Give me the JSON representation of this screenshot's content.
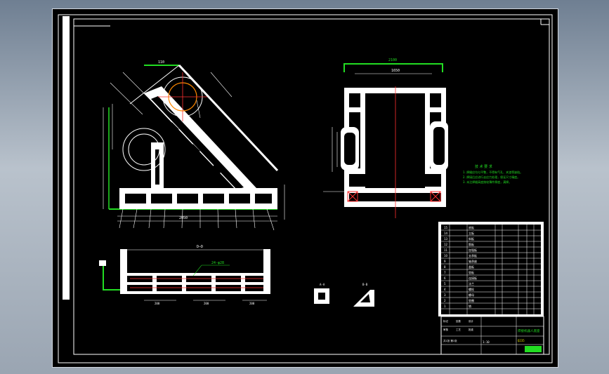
{
  "views": {
    "front_dim_top": "110",
    "front_dim_bottom": "2050",
    "top_view_overall": "2100",
    "top_view_inner": "1650",
    "side_view_label": "D—D",
    "side_dim_label": "24-φ28",
    "section_a_label": "A-A",
    "section_b_label": "B-B",
    "side_bottom_dims": [
      "200",
      "200",
      "200"
    ]
  },
  "notes": {
    "title": "技 术 要 求",
    "lines": [
      "1. 焊缝应均匀平整，不得有气孔、夹渣等缺陷。",
      "2. 焊接后应进行去应力处理，保证尺寸精度。",
      "3. 未注焊缝高度按较薄件厚度，满焊。"
    ]
  },
  "title_block": {
    "drawing_name": "焊接机器人底座",
    "scale": "1:10",
    "material": "Q235",
    "sheet": "共1张 第1张",
    "labels": [
      "标记",
      "处数",
      "设计",
      "审核",
      "工艺",
      "批准"
    ],
    "parts": [
      "底板",
      "立板",
      "斜板",
      "筋板",
      "加强板",
      "支承板",
      "轴承座",
      "盖板",
      "垫板",
      "连接板",
      "法兰",
      "螺栓",
      "螺母",
      "垫圈",
      "销"
    ]
  },
  "colors": {
    "outline": "#ffffff",
    "dimension": "#22dd22",
    "center": "#ff3030",
    "weld": "#ff8800",
    "accent_yellow": "#e6e600"
  }
}
